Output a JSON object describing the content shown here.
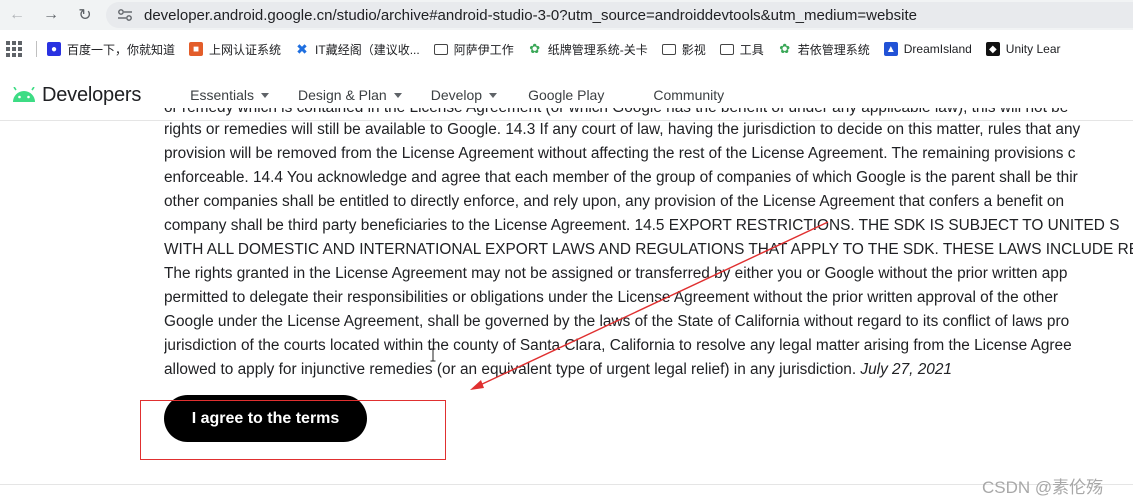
{
  "browser": {
    "url": "developer.android.google.cn/studio/archive#android-studio-3-0?utm_source=androiddevtools&utm_medium=website",
    "bookmarks": [
      {
        "label": "百度一下，你就知道",
        "icon": "baidu-paw-icon",
        "color": "#2932e1"
      },
      {
        "label": "上网认证系统",
        "icon": "campus-auth-icon",
        "color": "#e35d2a"
      },
      {
        "label": "IT藏经阁（建议收...",
        "icon": "butterfly-icon",
        "color": "#1f6fe0"
      },
      {
        "label": "阿萨伊工作",
        "icon": "folder-icon"
      },
      {
        "label": "纸牌管理系统-关卡",
        "icon": "leaf-icon",
        "color": "#3aa757"
      },
      {
        "label": "影视",
        "icon": "folder-icon"
      },
      {
        "label": "工具",
        "icon": "folder-icon"
      },
      {
        "label": "若依管理系统",
        "icon": "leaf-icon",
        "color": "#3aa757"
      },
      {
        "label": "DreamIsland",
        "icon": "dreamisland-icon",
        "color": "#2152d6"
      },
      {
        "label": "Unity Lear",
        "icon": "unity-icon",
        "color": "#111111"
      }
    ]
  },
  "header": {
    "logo_text": "Developers",
    "nav": [
      {
        "label": "Essentials",
        "dropdown": true
      },
      {
        "label": "Design & Plan",
        "dropdown": true
      },
      {
        "label": "Develop",
        "dropdown": true
      },
      {
        "label": "Google Play",
        "dropdown": false
      },
      {
        "label": "Community",
        "dropdown": false
      }
    ]
  },
  "content": {
    "lines": [
      "or remedy which is contained in the License Agreement (or which Google has the benefit of under any applicable law), this will not be",
      "rights or remedies will still be available to Google. 14.3 If any court of law, having the jurisdiction to decide on this matter, rules that any",
      "provision will be removed from the License Agreement without affecting the rest of the License Agreement. The remaining provisions c",
      "enforceable. 14.4 You acknowledge and agree that each member of the group of companies of which Google is the parent shall be thir",
      "other companies shall be entitled to directly enforce, and rely upon, any provision of the License Agreement that confers a benefit on",
      "company shall be third party beneficiaries to the License Agreement. 14.5 EXPORT RESTRICTIONS. THE SDK IS SUBJECT TO UNITED S",
      "WITH ALL DOMESTIC AND INTERNATIONAL EXPORT LAWS AND REGULATIONS THAT APPLY TO THE SDK. THESE LAWS INCLUDE REST",
      "The rights granted in the License Agreement may not be assigned or transferred by either you or Google without the prior written app",
      "permitted to delegate their responsibilities or obligations under the License Agreement without the prior written approval of the other",
      "Google under the License Agreement, shall be governed by the laws of the State of California without regard to its conflict of laws pro",
      "jurisdiction of the courts located within the county of Santa Clara, California to resolve any legal matter arising from the License Agree"
    ],
    "last_line": "allowed to apply for injunctive remedies (or an equivalent type of urgent legal relief) in any jurisdiction.",
    "date": "July 27, 2021",
    "agree_button": "I agree to the terms"
  },
  "annotation": {
    "color": "#e03030"
  },
  "watermark": "CSDN @素伦殇"
}
